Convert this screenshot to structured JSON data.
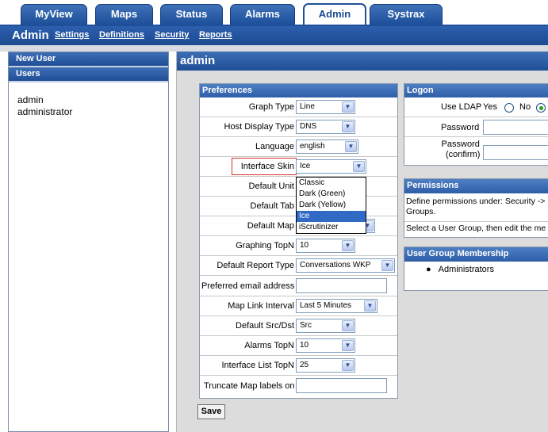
{
  "tabs": [
    {
      "label": "MyView"
    },
    {
      "label": "Maps"
    },
    {
      "label": "Status"
    },
    {
      "label": "Alarms"
    },
    {
      "label": "Admin"
    },
    {
      "label": "Systrax"
    }
  ],
  "subnav": {
    "section": "Admin",
    "links": [
      "Settings",
      "Definitions",
      "Security",
      "Reports"
    ]
  },
  "sidebar": {
    "new_user": "New User",
    "users_header": "Users",
    "users": [
      "admin",
      "administrator"
    ]
  },
  "main": {
    "title": "admin"
  },
  "preferences": {
    "header": "Preferences",
    "graph_type": {
      "label": "Graph Type",
      "value": "Line"
    },
    "host_display_type": {
      "label": "Host Display Type",
      "value": "DNS"
    },
    "language": {
      "label": "Language",
      "value": "english"
    },
    "interface_skin": {
      "label": "Interface Skin",
      "value": "Ice",
      "options": [
        "Classic",
        "Dark (Green)",
        "Dark (Yellow)",
        "Ice",
        "iScrutinizer"
      ]
    },
    "default_unit": {
      "label": "Default Unit"
    },
    "default_tab": {
      "label": "Default Tab"
    },
    "default_map": {
      "label": "Default Map"
    },
    "graphing_topn": {
      "label": "Graphing TopN",
      "value": "10"
    },
    "default_report_type": {
      "label": "Default Report Type",
      "value": "Conversations WKP"
    },
    "preferred_email": {
      "label": "Preferred email address",
      "value": ""
    },
    "map_link_interval": {
      "label": "Map Link Interval",
      "value": "Last 5 Minutes"
    },
    "default_src_dst": {
      "label": "Default Src/Dst",
      "value": "Src"
    },
    "alarms_topn": {
      "label": "Alarms TopN",
      "value": "10"
    },
    "interface_list_topn": {
      "label": "Interface List TopN",
      "value": "25"
    },
    "truncate_map_labels": {
      "label": "Truncate Map labels on",
      "value": ""
    },
    "save_label": "Save"
  },
  "logon": {
    "header": "Logon",
    "use_ldap": "Use LDAP",
    "yes": "Yes",
    "no": "No",
    "password": "Password",
    "password_confirm_1": "Password",
    "password_confirm_2": "(confirm)"
  },
  "permissions": {
    "header": "Permissions",
    "text1": "Define permissions under: Security ->",
    "text1b": "Groups.",
    "text2": "Select a User Group, then edit the me"
  },
  "membership": {
    "header": "User Group Membership",
    "groups": [
      "Administrators"
    ]
  }
}
